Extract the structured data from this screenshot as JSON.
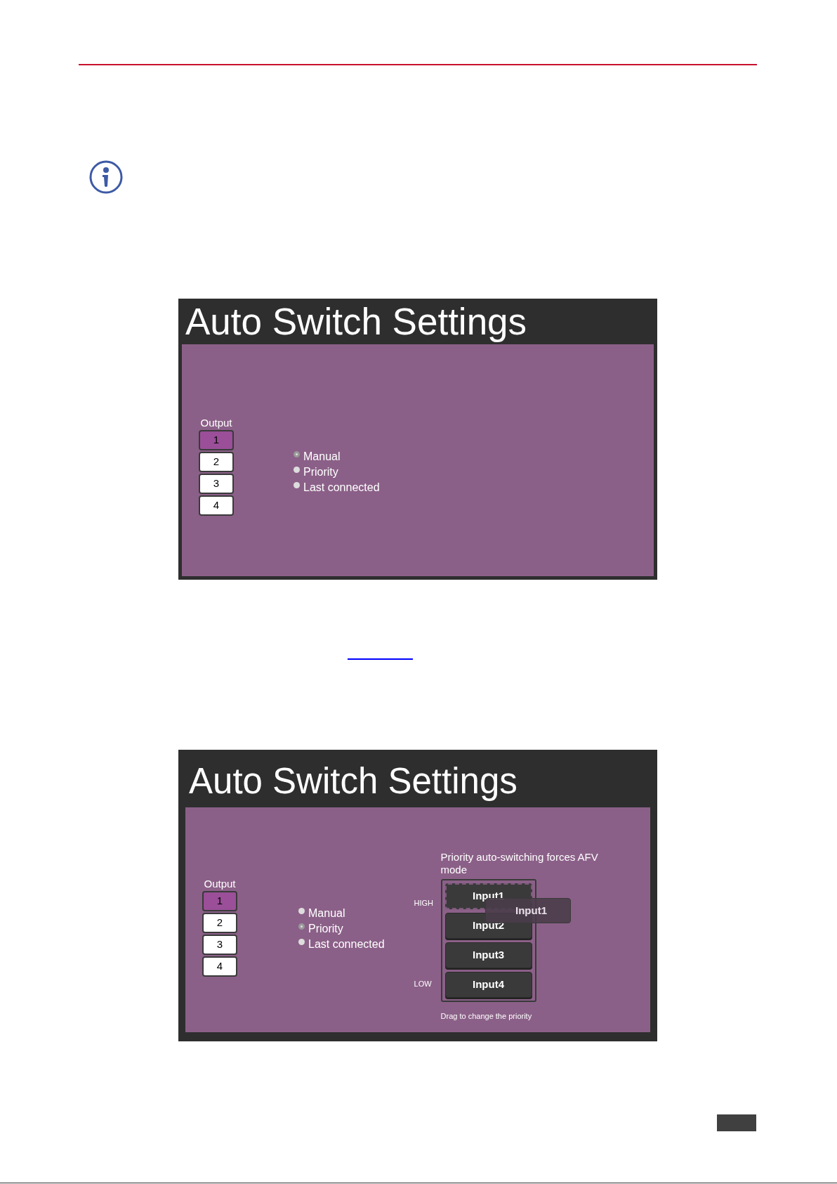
{
  "screens": [
    {
      "title": "Auto Switch Settings",
      "output_label": "Output",
      "outputs": [
        {
          "label": "1",
          "selected": true
        },
        {
          "label": "2",
          "selected": false
        },
        {
          "label": "3",
          "selected": false
        },
        {
          "label": "4",
          "selected": false
        }
      ],
      "modes": [
        {
          "label": "Manual",
          "selected": true
        },
        {
          "label": "Priority",
          "selected": false
        },
        {
          "label": "Last connected",
          "selected": false
        }
      ]
    },
    {
      "title": "Auto Switch Settings",
      "output_label": "Output",
      "outputs": [
        {
          "label": "1",
          "selected": true
        },
        {
          "label": "2",
          "selected": false
        },
        {
          "label": "3",
          "selected": false
        },
        {
          "label": "4",
          "selected": false
        }
      ],
      "modes": [
        {
          "label": "Manual",
          "selected": false
        },
        {
          "label": "Priority",
          "selected": true
        },
        {
          "label": "Last connected",
          "selected": false
        }
      ],
      "priority": {
        "note": "Priority auto-switching forces AFV mode",
        "high_label": "HIGH",
        "low_label": "LOW",
        "inputs": [
          {
            "label": "Input1",
            "dragging": true
          },
          {
            "label": "Input2",
            "dragging": false
          },
          {
            "label": "Input3",
            "dragging": false
          },
          {
            "label": "Input4",
            "dragging": false
          }
        ],
        "drag_ghost": "Input1",
        "hint": "Drag to change the priority"
      }
    }
  ]
}
